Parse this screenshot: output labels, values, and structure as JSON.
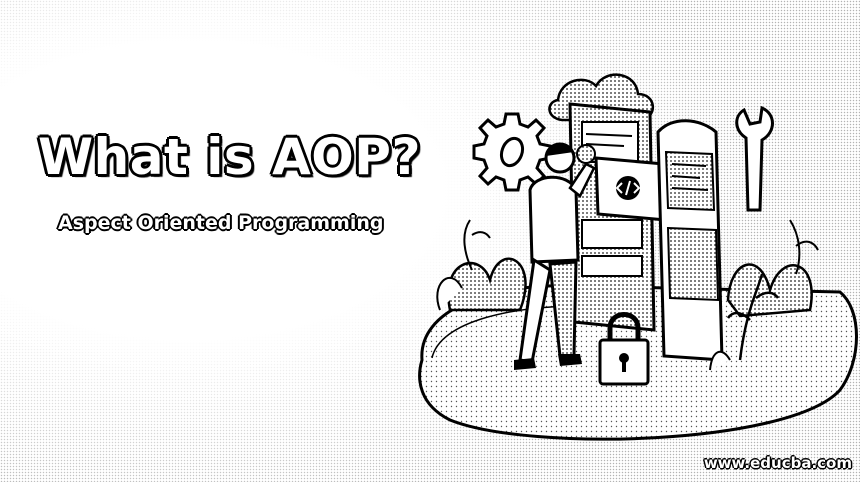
{
  "banner": {
    "title": "What is AOP?",
    "subtitle": "Aspect Oriented Programming",
    "watermark": "www.educba.com"
  },
  "illustration": {
    "icons": [
      "gear-icon",
      "cloud-icon",
      "code-icon",
      "lock-icon",
      "wrench-icon",
      "plant-icon"
    ],
    "style": "black-and-white stippled line art"
  },
  "colors": {
    "ink": "#000000",
    "paper": "#ffffff",
    "stipple": "#9a9a9a"
  }
}
